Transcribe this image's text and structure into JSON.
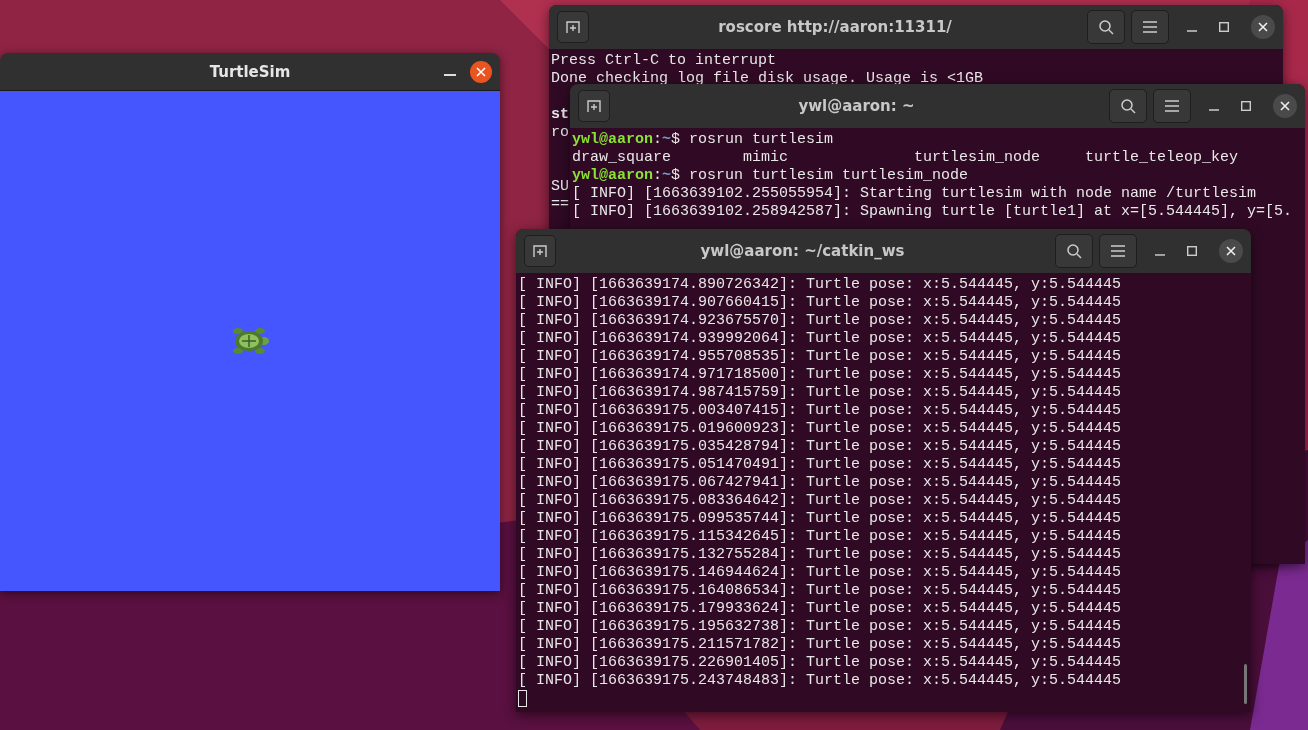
{
  "turtlesim": {
    "title": "TurtleSim"
  },
  "terminals": [
    {
      "title": "roscore http://aaron:11311/",
      "lines": [
        {
          "kind": "text",
          "text": "Press Ctrl-C to interrupt"
        },
        {
          "kind": "text",
          "text": "Done checking log file disk usage. Usage is <1GB"
        },
        {
          "kind": "blank"
        },
        {
          "kind": "bold",
          "text": "st"
        },
        {
          "kind": "text",
          "text": "ro"
        },
        {
          "kind": "blank"
        },
        {
          "kind": "blank"
        },
        {
          "kind": "text",
          "text": "SU"
        },
        {
          "kind": "text",
          "text": "=="
        }
      ]
    },
    {
      "title": "ywl@aaron: ~",
      "lines": [
        {
          "kind": "prompt",
          "user": "ywl@aaron",
          "sep": ":",
          "path": "~",
          "symbol": "$",
          "command": "rosrun turtlesim"
        },
        {
          "kind": "text",
          "text": "draw_square        mimic              turtlesim_node     turtle_teleop_key"
        },
        {
          "kind": "prompt",
          "user": "ywl@aaron",
          "sep": ":",
          "path": "~",
          "symbol": "$",
          "command": "rosrun turtlesim turtlesim_node"
        },
        {
          "kind": "text",
          "text": "[ INFO] [1663639102.255055954]: Starting turtlesim with node name /turtlesim"
        },
        {
          "kind": "text",
          "text": "[ INFO] [1663639102.258942587]: Spawning turtle [turtle1] at x=[5.544445], y=[5."
        }
      ]
    },
    {
      "title": "ywl@aaron: ~/catkin_ws",
      "lines": [
        {
          "kind": "text",
          "text": "[ INFO] [1663639174.890726342]: Turtle pose: x:5.544445, y:5.544445"
        },
        {
          "kind": "text",
          "text": "[ INFO] [1663639174.907660415]: Turtle pose: x:5.544445, y:5.544445"
        },
        {
          "kind": "text",
          "text": "[ INFO] [1663639174.923675570]: Turtle pose: x:5.544445, y:5.544445"
        },
        {
          "kind": "text",
          "text": "[ INFO] [1663639174.939992064]: Turtle pose: x:5.544445, y:5.544445"
        },
        {
          "kind": "text",
          "text": "[ INFO] [1663639174.955708535]: Turtle pose: x:5.544445, y:5.544445"
        },
        {
          "kind": "text",
          "text": "[ INFO] [1663639174.971718500]: Turtle pose: x:5.544445, y:5.544445"
        },
        {
          "kind": "text",
          "text": "[ INFO] [1663639174.987415759]: Turtle pose: x:5.544445, y:5.544445"
        },
        {
          "kind": "text",
          "text": "[ INFO] [1663639175.003407415]: Turtle pose: x:5.544445, y:5.544445"
        },
        {
          "kind": "text",
          "text": "[ INFO] [1663639175.019600923]: Turtle pose: x:5.544445, y:5.544445"
        },
        {
          "kind": "text",
          "text": "[ INFO] [1663639175.035428794]: Turtle pose: x:5.544445, y:5.544445"
        },
        {
          "kind": "text",
          "text": "[ INFO] [1663639175.051470491]: Turtle pose: x:5.544445, y:5.544445"
        },
        {
          "kind": "text",
          "text": "[ INFO] [1663639175.067427941]: Turtle pose: x:5.544445, y:5.544445"
        },
        {
          "kind": "text",
          "text": "[ INFO] [1663639175.083364642]: Turtle pose: x:5.544445, y:5.544445"
        },
        {
          "kind": "text",
          "text": "[ INFO] [1663639175.099535744]: Turtle pose: x:5.544445, y:5.544445"
        },
        {
          "kind": "text",
          "text": "[ INFO] [1663639175.115342645]: Turtle pose: x:5.544445, y:5.544445"
        },
        {
          "kind": "text",
          "text": "[ INFO] [1663639175.132755284]: Turtle pose: x:5.544445, y:5.544445"
        },
        {
          "kind": "text",
          "text": "[ INFO] [1663639175.146944624]: Turtle pose: x:5.544445, y:5.544445"
        },
        {
          "kind": "text",
          "text": "[ INFO] [1663639175.164086534]: Turtle pose: x:5.544445, y:5.544445"
        },
        {
          "kind": "text",
          "text": "[ INFO] [1663639175.179933624]: Turtle pose: x:5.544445, y:5.544445"
        },
        {
          "kind": "text",
          "text": "[ INFO] [1663639175.195632738]: Turtle pose: x:5.544445, y:5.544445"
        },
        {
          "kind": "text",
          "text": "[ INFO] [1663639175.211571782]: Turtle pose: x:5.544445, y:5.544445"
        },
        {
          "kind": "text",
          "text": "[ INFO] [1663639175.226901405]: Turtle pose: x:5.544445, y:5.544445"
        },
        {
          "kind": "text",
          "text": "[ INFO] [1663639175.243748483]: Turtle pose: x:5.544445, y:5.544445"
        }
      ],
      "cursor": true
    }
  ]
}
